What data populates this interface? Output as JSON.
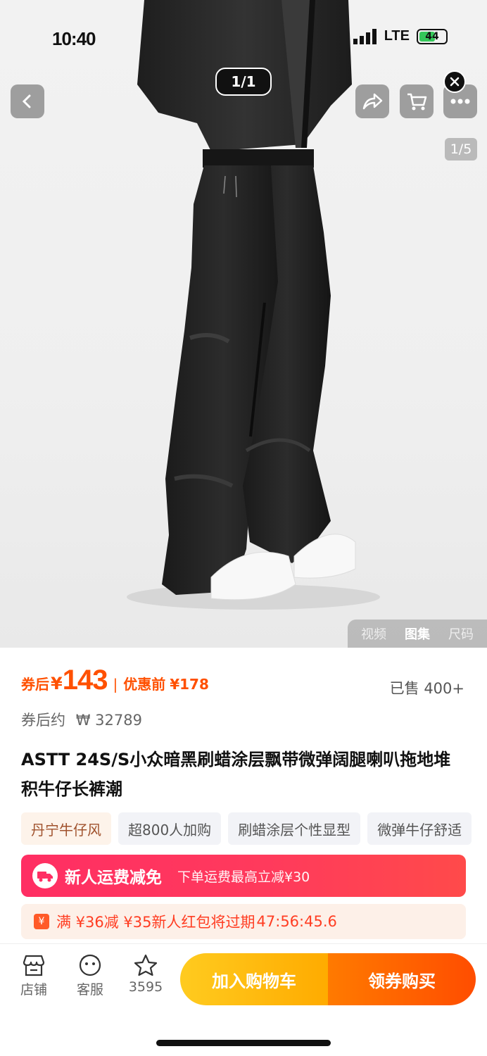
{
  "status_bar": {
    "time": "10:40",
    "network": "LTE",
    "battery": "44"
  },
  "gallery": {
    "counter": "1/1",
    "page_badge": "1/5",
    "media_tabs": [
      "视频",
      "图集",
      "尺码"
    ],
    "active_tab": "图集"
  },
  "price": {
    "after_coupon_label": "券后",
    "currency": "¥",
    "after_coupon_value": "143",
    "separator": "|",
    "before_label": "优惠前",
    "before_value": "¥178",
    "sold": "已售 400+",
    "approx_label": "券后约",
    "approx_value": "₩ 32789"
  },
  "product": {
    "title": "ASTT 24S/S小众暗黑刷蜡涂层飘带微弹阔腿喇叭拖地堆积牛仔长裤潮"
  },
  "tags": [
    "丹宁牛仔风",
    "超800人加购",
    "刷蜡涂层个性显型",
    "微弹牛仔舒适"
  ],
  "promo": {
    "main": "新人运费减免",
    "sub": "下单运费最高立减¥30"
  },
  "coupon": {
    "text": "满 ¥36减 ¥35新人红包将过期",
    "countdown": "47:56:45.6"
  },
  "bottom_bar": {
    "shop": "店铺",
    "service": "客服",
    "favorites": "3595",
    "add_to_cart": "加入购物车",
    "buy": "领券购买"
  },
  "colors": {
    "accent": "#ff5000",
    "promo": "#ff2e63",
    "cart": "#ffb800",
    "buy": "#ff5500"
  }
}
